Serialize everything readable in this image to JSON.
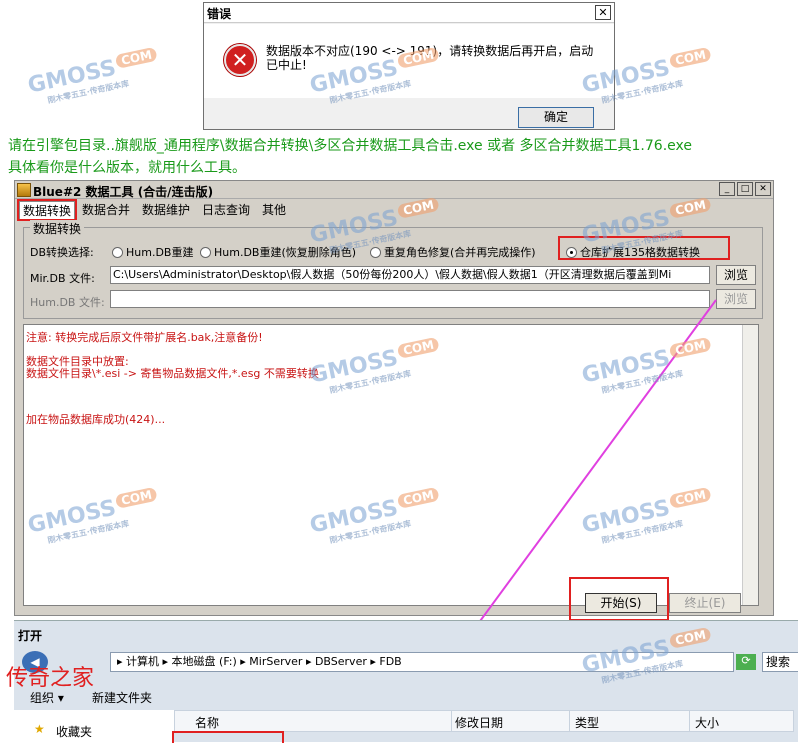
{
  "error_dialog": {
    "title": "错误",
    "close": "✕",
    "message": "数据版本不对应(190 <-> 191)，请转换数据后再开启，启动已中止!",
    "ok_label": "确定"
  },
  "instructions": {
    "line1": "请在引擎包目录..旗舰版_通用程序\\数据合并转换\\多区合并数据工具合击.exe 或者 多区合并数据工具1.76.exe",
    "line2": "具体看你是什么版本，就用什么工具。"
  },
  "main_window": {
    "title": "Blue#2 数据工具 (合击/连击版)",
    "btn_min": "_",
    "btn_max": "□",
    "btn_close": "✕",
    "tabs": [
      "数据转换",
      "数据合并",
      "数据维护",
      "日志查询",
      "其他"
    ],
    "group_caption": "数据转换",
    "db_select_label": "DB转换选择:",
    "radios": [
      {
        "label": "Hum.DB重建",
        "checked": false
      },
      {
        "label": "Hum.DB重建(恢复删除角色)",
        "checked": false
      },
      {
        "label": "重复角色修复(合并再完成操作)",
        "checked": false
      },
      {
        "label": "仓库扩展135格数据转换",
        "checked": true
      }
    ],
    "mir_label": "Mir.DB 文件:",
    "mir_value": "C:\\Users\\Administrator\\Desktop\\假人数据（50份每份200人）\\假人数据\\假人数据1（开区清理数据后覆盖到Mi",
    "hum_label": "Hum.DB 文件:",
    "hum_value": "",
    "browse1": "浏览",
    "browse2": "浏览",
    "log_lines": [
      "注意: 转换完成后原文件带扩展名.bak,注意备份!",
      "数据文件目录中放置:",
      "数据文件目录\\*.esi      ->   寄售物品数据文件,*.esg 不需要转换",
      "加在物品数据库成功(424)..."
    ],
    "start_label": "开始(S)",
    "stop_label": "终止(E)"
  },
  "open_dialog": {
    "title": "打开",
    "address": "▸ 计算机 ▸ 本地磁盘 (F:) ▸ MirServer ▸ DBServer ▸ FDB",
    "search_placeholder": "搜索",
    "organize": "组织 ▾",
    "new_folder": "新建文件夹",
    "favorites": "收藏夹",
    "columns": [
      "名称",
      "修改日期",
      "类型",
      "大小"
    ]
  },
  "overlay_text": "传奇之家",
  "watermark": {
    "brand": "GMOSS",
    "tag": "COM",
    "sub": "刚木零五五·传奇版本库"
  },
  "colors": {
    "highlight": "#e02020",
    "arrow": "#e040e0",
    "green_text": "#1a9a1a",
    "log_text": "#c81414"
  }
}
